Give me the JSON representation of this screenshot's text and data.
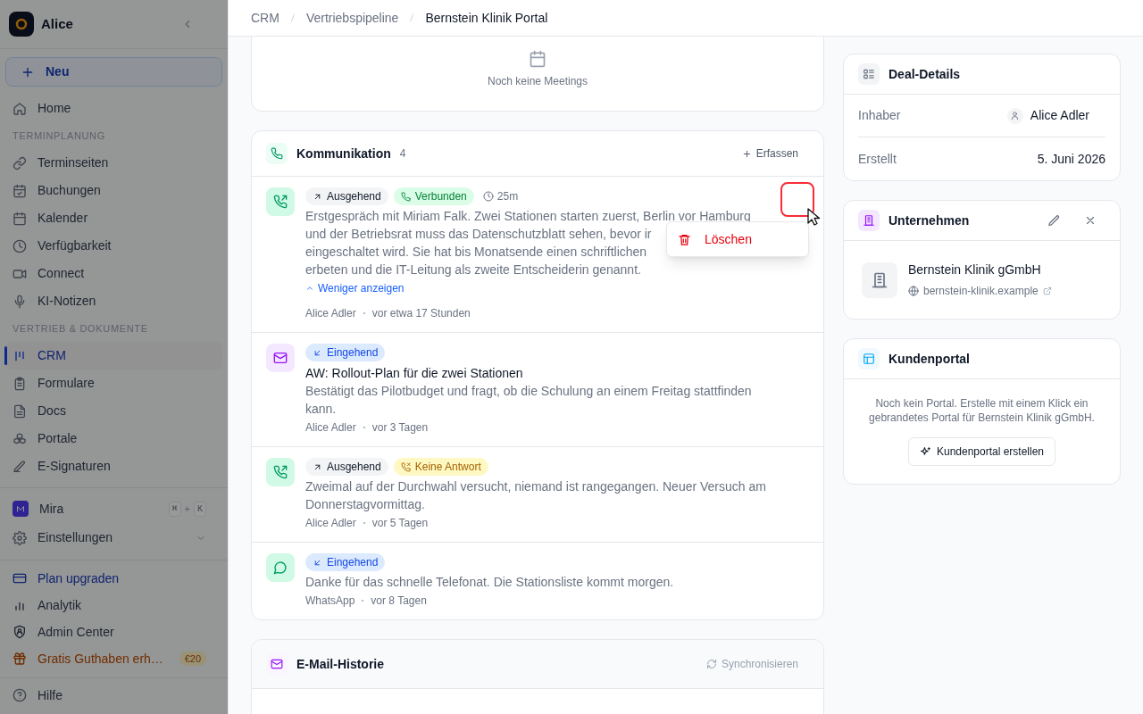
{
  "sidebar": {
    "workspace": "Alice",
    "new_button": "Neu",
    "sections": [
      {
        "items": [
          {
            "label": "Home",
            "selected": false
          }
        ]
      },
      {
        "heading": "TERMINPLANUNG",
        "items": [
          {
            "label": "Terminseiten",
            "selected": false
          },
          {
            "label": "Buchungen",
            "selected": false
          },
          {
            "label": "Kalender",
            "selected": false
          },
          {
            "label": "Verfügbarkeit",
            "selected": false
          },
          {
            "label": "Connect",
            "selected": false
          },
          {
            "label": "KI-Notizen",
            "selected": false
          }
        ]
      },
      {
        "heading": "VERTRIEB & DOKUMENTE",
        "items": [
          {
            "label": "CRM",
            "selected": true
          },
          {
            "label": "Formulare",
            "selected": false
          },
          {
            "label": "Docs",
            "selected": false
          },
          {
            "label": "Portale",
            "selected": false
          },
          {
            "label": "E-Signaturen",
            "selected": false
          }
        ]
      }
    ],
    "assistant": {
      "label": "Mira",
      "shortcut": [
        "⌘",
        "+",
        "K"
      ]
    },
    "settings": {
      "label": "Einstellungen"
    },
    "footer_items": [
      {
        "label": "Plan upgraden",
        "kind": "upgrade"
      },
      {
        "label": "Analytik",
        "kind": "plain"
      },
      {
        "label": "Admin Center",
        "kind": "plain"
      },
      {
        "label": "Gratis Guthaben erh…",
        "kind": "promo",
        "badge": "€20"
      }
    ],
    "help": {
      "label": "Hilfe"
    }
  },
  "breadcrumb": [
    "CRM",
    "Vertriebspipeline",
    "Bernstein Klinik Portal"
  ],
  "meetings": {
    "empty_text": "Noch keine Meetings"
  },
  "communication": {
    "title": "Kommunikation",
    "count": "4",
    "add_button": "Erfassen",
    "items": [
      {
        "kind": "call",
        "direction": {
          "kind": "outgoing",
          "label": "Ausgehend"
        },
        "status": {
          "kind": "connected",
          "label": "Verbunden"
        },
        "duration": "25m",
        "body_lines": [
          "Erstgespräch mit Miriam Falk. Zwei Stationen starten zuerst, Berlin vor Hamburg",
          "und der Betriebsrat muss das Datenschutzblatt sehen, bevor ir",
          "eingeschaltet wird. Sie hat bis Monatsende einen schriftlichen",
          "erbeten und die IT-Leitung als zweite Entscheiderin genannt."
        ],
        "toggle": "Weniger anzeigen",
        "author": "Alice Adler",
        "time": "vor etwa 17 Stunden",
        "menu": [
          {
            "label": "Löschen",
            "kind": "danger"
          }
        ]
      },
      {
        "kind": "email",
        "direction": {
          "kind": "incoming",
          "label": "Eingehend"
        },
        "subject": "AW: Rollout-Plan für die zwei Stationen",
        "body": "Bestätigt das Pilotbudget und fragt, ob die Schulung an einem Freitag stattfinden kann.",
        "author": "Alice Adler",
        "time": "vor 3 Tagen"
      },
      {
        "kind": "call",
        "direction": {
          "kind": "outgoing",
          "label": "Ausgehend"
        },
        "status": {
          "kind": "no_answer",
          "label": "Keine Antwort"
        },
        "body": "Zweimal auf der Durchwahl versucht, niemand ist rangegangen. Neuer Versuch am Donnerstagvormittag.",
        "author": "Alice Adler",
        "time": "vor 5 Tagen"
      },
      {
        "kind": "whatsapp",
        "direction": {
          "kind": "incoming",
          "label": "Eingehend"
        },
        "body": "Danke für das schnelle Telefonat. Die Stationsliste kommt morgen.",
        "author": "WhatsApp",
        "time": "vor 8 Tagen"
      }
    ]
  },
  "email_history": {
    "title": "E-Mail-Historie",
    "sync_button": {
      "label": "Synchronisieren",
      "disabled": true
    }
  },
  "deal_details": {
    "title": "Deal-Details",
    "rows": [
      {
        "label": "Inhaber",
        "value": "Alice Adler",
        "kind": "person"
      },
      {
        "label": "Erstellt",
        "value": "5. Juni 2026",
        "kind": "text"
      }
    ]
  },
  "company": {
    "title": "Unternehmen",
    "name": "Bernstein Klinik gGmbH",
    "website": "bernstein-klinik.example"
  },
  "portal": {
    "title": "Kundenportal",
    "text": "Noch kein Portal. Erstelle mit einem Klick ein gebrandetes Portal für Bernstein Klinik gGmbH.",
    "button": "Kundenportal erstellen"
  }
}
